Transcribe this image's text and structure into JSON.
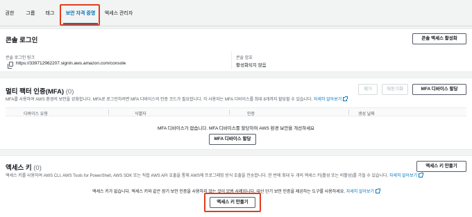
{
  "tabs": [
    "권한",
    "그룹",
    "태그",
    "보안 자격 증명",
    "액세스 관리자"
  ],
  "console": {
    "title": "콘솔 로그인",
    "manage_button": "콘솔 액세스 활성화",
    "link_label": "콘솔 로그인 링크",
    "link_value": "https://339712962207.signin.aws.amazon.com/console",
    "password_label": "콘솔 암호",
    "password_value": "활성화되지 않음"
  },
  "mfa": {
    "title": "멀티 팩터 인증(MFA)",
    "count": "(0)",
    "remove_button": "제거",
    "resync_button": "재동기화",
    "assign_button": "MFA 디바이스 할당",
    "description": "MFA를 사용하여 AWS 환경의 보안을 강화합니다. MFA로 로그인하려면 MFA 디바이스의 인증 코드가 필요합니다. 각 사용자는 MFA 디바이스를 최대 8개까지 할당할 수 있습니다.",
    "learn_more": "자세히 알아보기",
    "columns": [
      "디바이스 유형",
      "식별자",
      "인증",
      "생성 날짜"
    ],
    "empty_text": "MFA 디바이스가 없습니다. MFA 디바이스를 할당하여 AWS 환경 보안을 개선하세요",
    "empty_button": "MFA 디바이스 할당"
  },
  "access_keys": {
    "title": "액세스 키",
    "count": "(0)",
    "create_button": "액세스 키 만들기",
    "description": "액세스 키를 사용하여 AWS CLI, AWS Tools for PowerShell, AWS SDK 또는 직접 AWS API 호출을 통해 AWS에 프로그래밍 방식 호출을 전송합니다. 한 번에 최대 두 개의 액세스 키(활성 또는 비활성)를 가질 수 있습니다.",
    "learn_more": "자세히 알아보기",
    "empty_text": "액세스 키가 없습니다. 액세스 키와 같은 장기 보안 인증을 사용하지 않는 것이 모범 사례입니다. 대신 단기 보안 인증을 제공하는 도구를 사용하세요.",
    "empty_learn_more": "자세히 알아보기",
    "empty_button": "액세스 키 만들기"
  },
  "colors": {
    "accent": "#0073bb",
    "highlight": "#e03c1b"
  }
}
